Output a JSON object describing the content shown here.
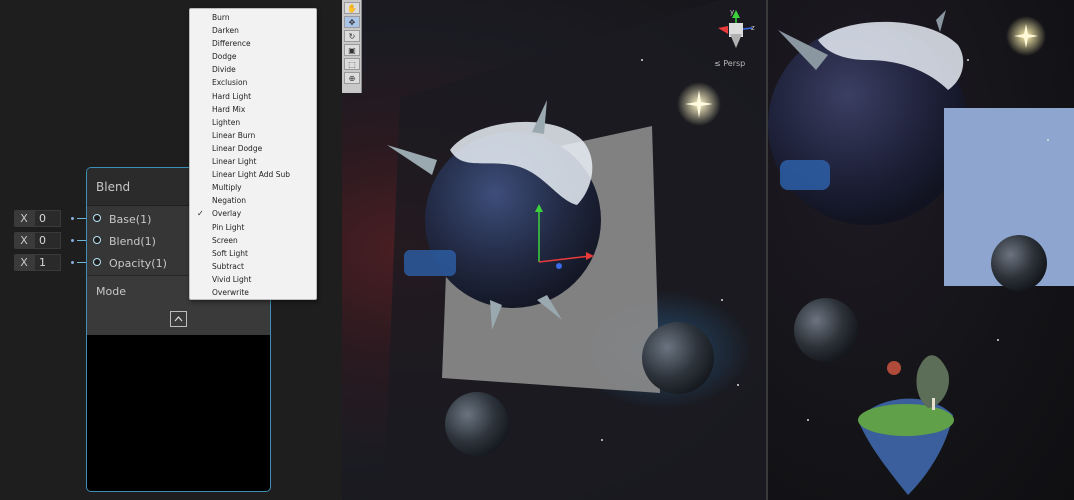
{
  "node": {
    "title": "Blend",
    "inputs": [
      {
        "axis": "X",
        "value": "0",
        "label": "Base(1)"
      },
      {
        "axis": "X",
        "value": "0",
        "label": "Blend(1)"
      },
      {
        "axis": "X",
        "value": "1",
        "label": "Opacity(1)"
      }
    ],
    "mode_label": "Mode"
  },
  "dropdown": {
    "items": [
      "Burn",
      "Darken",
      "Difference",
      "Dodge",
      "Divide",
      "Exclusion",
      "Hard Light",
      "Hard Mix",
      "Lighten",
      "Linear Burn",
      "Linear Dodge",
      "Linear Light",
      "Linear Light Add Sub",
      "Multiply",
      "Negation",
      "Overlay",
      "Pin Light",
      "Screen",
      "Soft Light",
      "Subtract",
      "Vivid Light",
      "Overwrite"
    ],
    "selected": "Overlay",
    "check_glyph": "✓"
  },
  "scene": {
    "projection_label": "≤ Persp",
    "gizmo_axes": {
      "y": "y",
      "z": "z"
    }
  },
  "colors": {
    "node_border": "#3d8fb3",
    "wire": "#6fb6d8"
  }
}
